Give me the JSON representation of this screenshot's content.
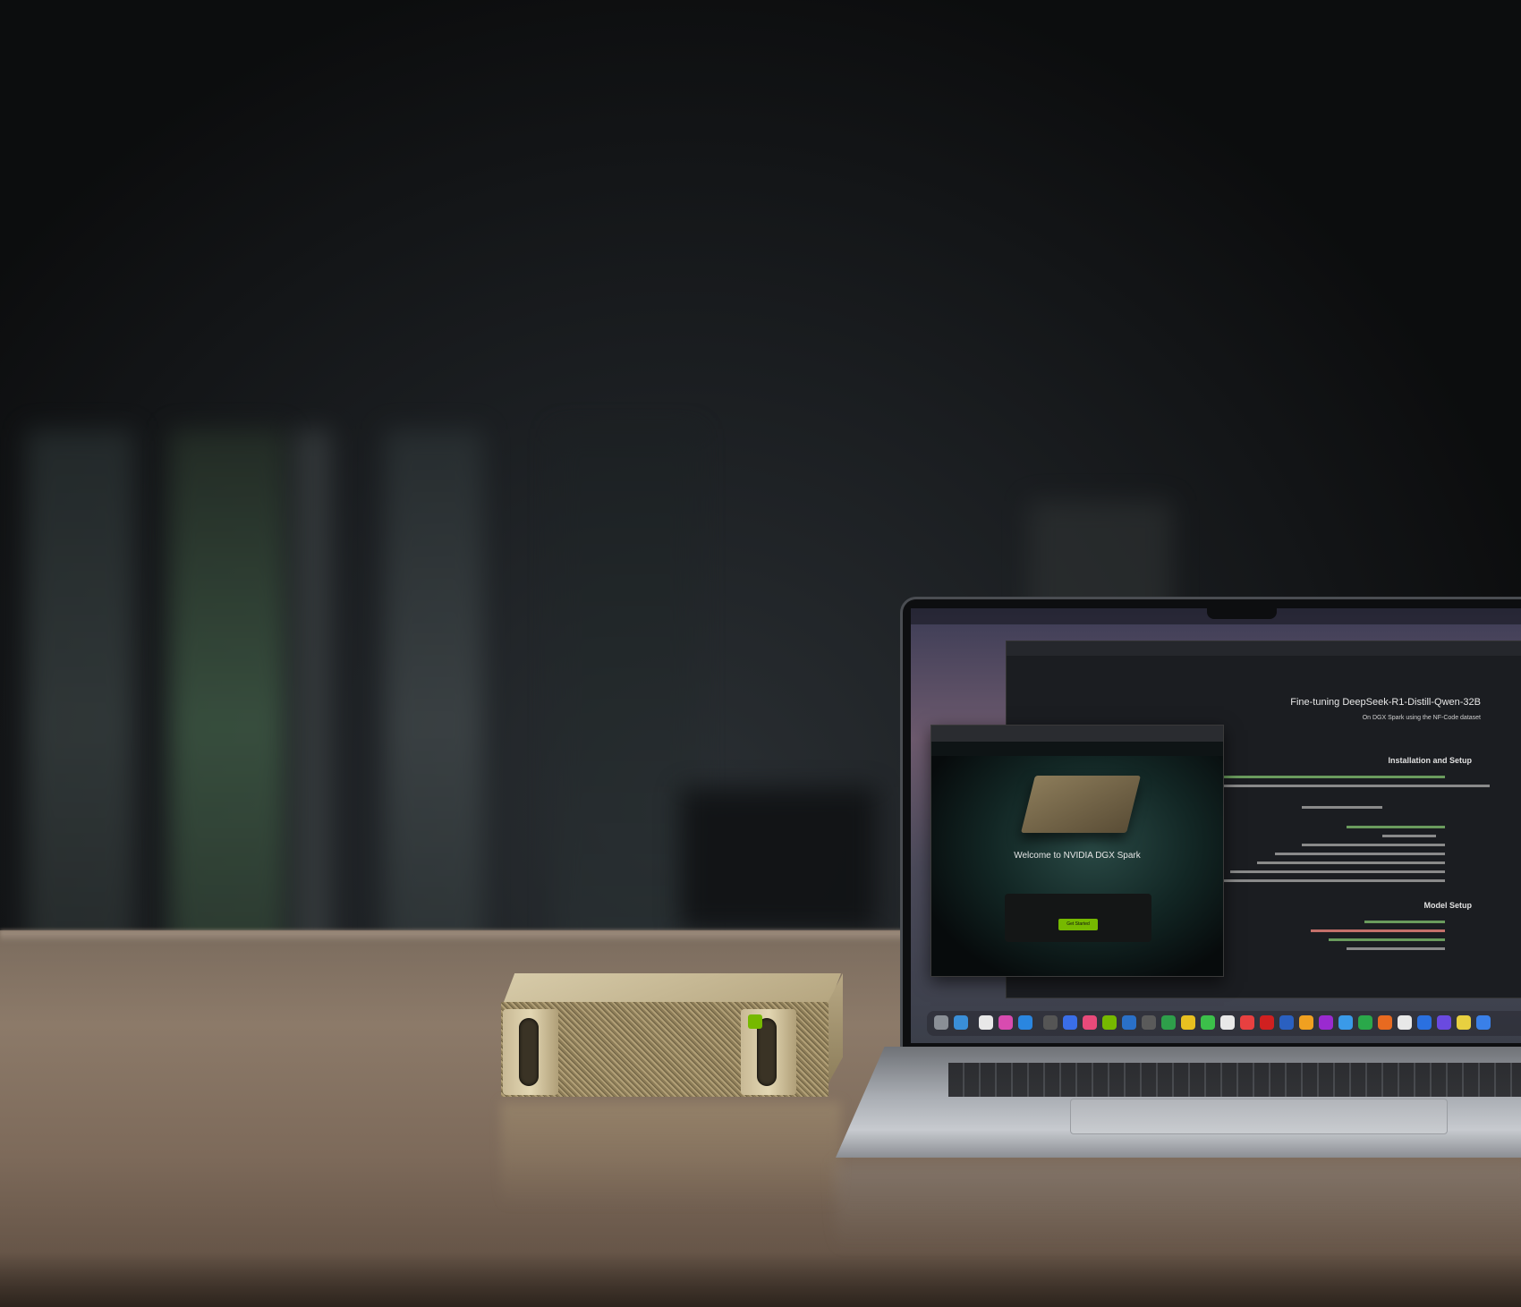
{
  "laptop": {
    "notebook": {
      "title": "Fine-tuning DeepSeek-R1-Distill-Qwen-32B",
      "subtitle": "On DGX Spark using the NF-Code dataset",
      "section_install": "Installation and Setup",
      "section_model": "Model Setup"
    },
    "welcome_window": {
      "title": "Welcome to NVIDIA DGX Spark",
      "button": "Get Started"
    }
  },
  "colors": {
    "nvidia_green": "#76b900",
    "device_gold": "#b3a37d"
  }
}
